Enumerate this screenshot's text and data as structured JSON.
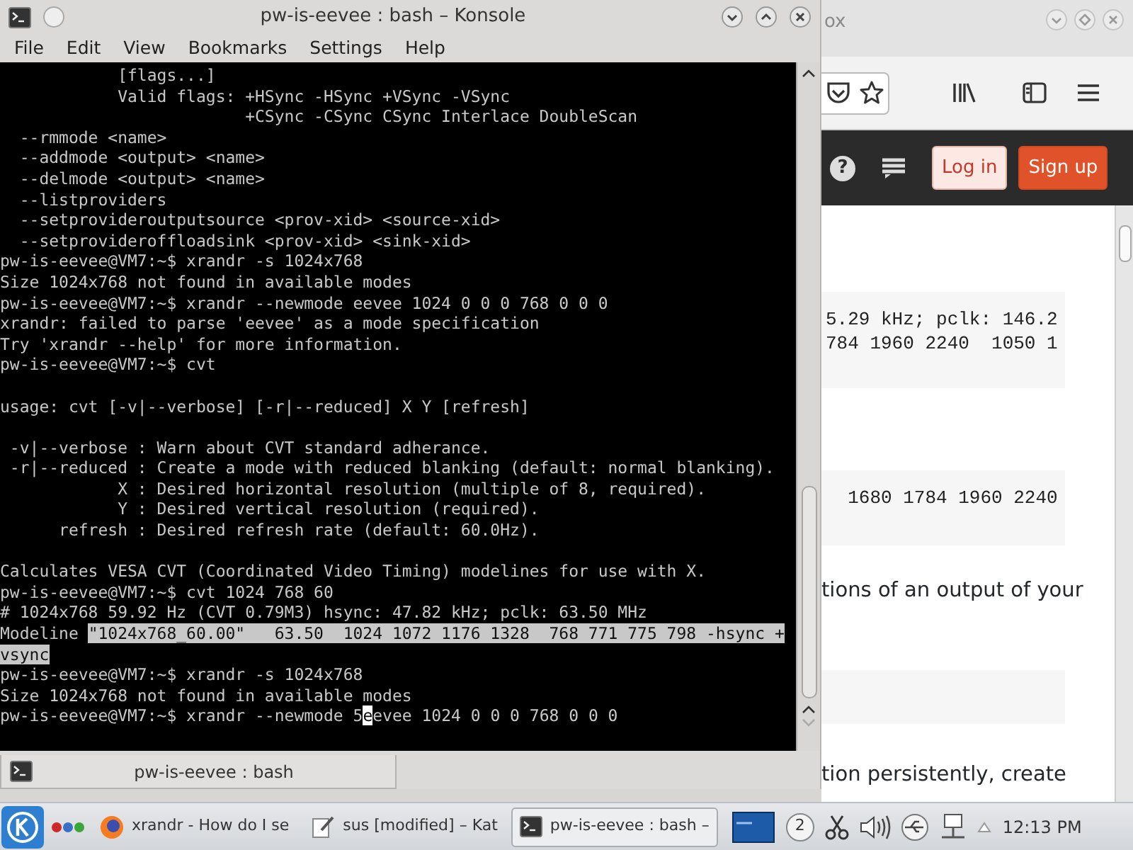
{
  "konsole": {
    "title": "pw-is-eevee : bash – Konsole",
    "menu": [
      "File",
      "Edit",
      "View",
      "Bookmarks",
      "Settings",
      "Help"
    ],
    "terminal": {
      "blocks": [
        [
          "            [flags...]",
          "            Valid flags: +HSync -HSync +VSync -VSync",
          "                         +CSync -CSync CSync Interlace DoubleScan",
          "  --rmmode <name>",
          "  --addmode <output> <name>",
          "  --delmode <output> <name>",
          "  --listproviders",
          "  --setprovideroutputsource <prov-xid> <source-xid>",
          "  --setprovideroffloadsink <prov-xid> <sink-xid>",
          "pw-is-eevee@VM7:~$ xrandr -s 1024x768",
          "Size 1024x768 not found in available modes",
          "pw-is-eevee@VM7:~$ xrandr --newmode eevee 1024 0 0 0 768 0 0 0",
          "xrandr: failed to parse 'eevee' as a mode specification",
          "Try 'xrandr --help' for more information.",
          "pw-is-eevee@VM7:~$ cvt"
        ],
        [
          "usage: cvt [-v|--verbose] [-r|--reduced] X Y [refresh]"
        ],
        [
          " -v|--verbose : Warn about CVT standard adherance.",
          " -r|--reduced : Create a mode with reduced blanking (default: normal blanking).",
          "            X : Desired horizontal resolution (multiple of 8, required).",
          "            Y : Desired vertical resolution (required).",
          "      refresh : Desired refresh rate (default: 60.0Hz)."
        ],
        [
          "Calculates VESA CVT (Coordinated Video Timing) modelines for use with X.",
          "pw-is-eevee@VM7:~$ cvt 1024 768 60",
          "# 1024x768 59.92 Hz (CVT 0.79M3) hsync: 47.82 kHz; pclk: 63.50 MHz",
          [
            {
              "kind": "plain",
              "text": "Modeline "
            },
            {
              "kind": "selection",
              "text": "\"1024x768_60.00\"   63.50  1024 1072 1176 1328  768 771 775 798 -hsync +"
            }
          ],
          [
            {
              "kind": "selection",
              "text": "vsync"
            }
          ],
          "pw-is-eevee@VM7:~$ xrandr -s 1024x768",
          "Size 1024x768 not found in available modes",
          [
            {
              "kind": "plain",
              "text": "pw-is-eevee@VM7:~$ xrandr --newmode 5"
            },
            {
              "kind": "cursor",
              "text": "e"
            },
            {
              "kind": "plain",
              "text": "evee 1024 0 0 0 768 0 0 0"
            }
          ]
        ]
      ]
    },
    "tabs": [
      {
        "label": "pw-is-eevee : bash",
        "selected": true
      }
    ]
  },
  "browser": {
    "title": "ox",
    "help_icon": "?",
    "header_buttons": [
      {
        "label": "Log in",
        "kind": "secondary"
      },
      {
        "label": "Sign up",
        "kind": "primary"
      }
    ],
    "content": [
      {
        "kind": "code",
        "lines": [
          "5.29 kHz; pclk: 146.2",
          "784 1960 2240  1050 1"
        ]
      },
      {
        "kind": "code",
        "lines": [
          "  1680 1784 1960 2240"
        ]
      },
      {
        "kind": "text",
        "text": "tions of an output of your"
      },
      {
        "kind": "code"
      },
      {
        "kind": "text",
        "text": "tion persistently, create"
      }
    ]
  },
  "taskbar": {
    "tasks": [
      {
        "kind": "browser",
        "label": "xrandr - How do I se",
        "selected": false
      },
      {
        "kind": "editor",
        "label": "sus [modified] – Kat",
        "selected": false
      },
      {
        "kind": "terminal",
        "label": "pw-is-eevee : bash –",
        "selected": true
      }
    ],
    "notification_count": "2",
    "clock": "12:13 PM"
  }
}
